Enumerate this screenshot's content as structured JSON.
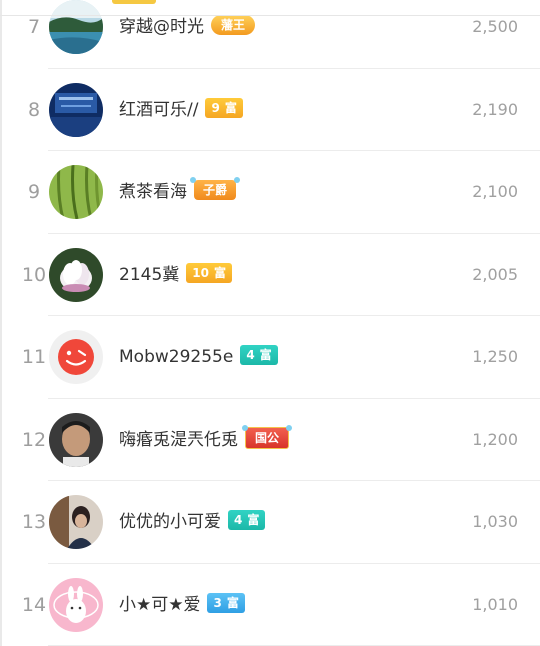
{
  "rows": [
    {
      "rank": "7",
      "name": "穿越@时光",
      "badge": {
        "num": "",
        "text": "藩王",
        "style": "crown"
      },
      "score": "2,500"
    },
    {
      "rank": "8",
      "name": "红酒可乐//",
      "badge": {
        "num": "9",
        "text": "富",
        "style": "gold"
      },
      "score": "2,190"
    },
    {
      "rank": "9",
      "name": "煮茶看海",
      "badge": {
        "num": "",
        "text": "子爵",
        "style": "orange"
      },
      "score": "2,100"
    },
    {
      "rank": "10",
      "name": "2145冀",
      "badge": {
        "num": "10",
        "text": "富",
        "style": "gold"
      },
      "score": "2,005"
    },
    {
      "rank": "11",
      "name": "Mobw29255e",
      "badge": {
        "num": "4",
        "text": "富",
        "style": "teal"
      },
      "score": "1,250"
    },
    {
      "rank": "12",
      "name": "嗨痻兎湜兲仛兎",
      "badge": {
        "num": "",
        "text": "国公",
        "style": "red"
      },
      "score": "1,200"
    },
    {
      "rank": "13",
      "name": "优优的小可爱",
      "badge": {
        "num": "4",
        "text": "富",
        "style": "teal"
      },
      "score": "1,030"
    },
    {
      "rank": "14",
      "name": "小★可★爱",
      "badge": {
        "num": "3",
        "text": "富",
        "style": "blue"
      },
      "score": "1,010"
    }
  ],
  "colors": {
    "gold": "#f5a623",
    "teal": "#1cb8a8",
    "blue": "#2f9fe4",
    "red": "#d8342a"
  }
}
